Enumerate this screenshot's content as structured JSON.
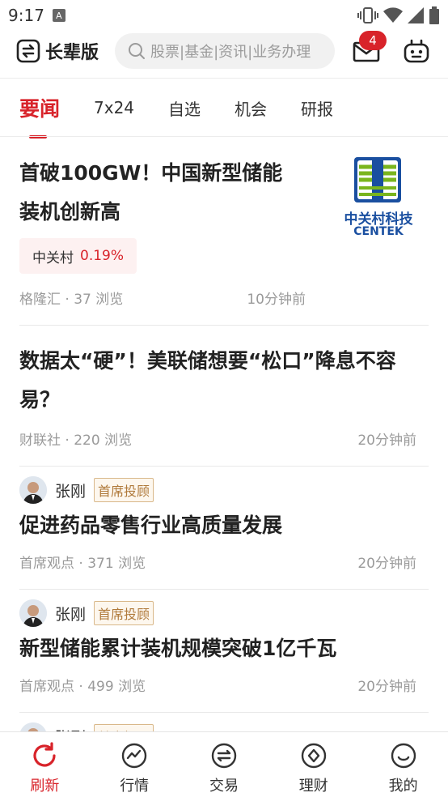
{
  "status_bar": {
    "time": "9:17",
    "notification_glyph": "A"
  },
  "header": {
    "mode_label": "长辈版",
    "search_placeholder": "股票|基金|资讯|业务办理",
    "mail_badge": "4"
  },
  "tabs": [
    {
      "label": "要闻",
      "active": true
    },
    {
      "label": "7x24",
      "active": false
    },
    {
      "label": "自选",
      "active": false
    },
    {
      "label": "机会",
      "active": false
    },
    {
      "label": "研报",
      "active": false
    }
  ],
  "articles": [
    {
      "title_line1": "首破100GW！中国新型储能",
      "title_line2": "装机创新高",
      "stock_name": "中关村",
      "stock_change": "0.19%",
      "source": "格隆汇 · 37 浏览",
      "time": "10分钟前",
      "logo_cn": "中关村科技",
      "logo_en": "CENTEK"
    },
    {
      "title_line1": "数据太“硬”！美联储想要“松口”降息不容",
      "title_line2": "易？",
      "source": "财联社 · 220 浏览",
      "time": "20分钟前"
    },
    {
      "author": "张刚",
      "author_tag": "首席投顾",
      "title": "促进药品零售行业高质量发展",
      "source": "首席观点 · 371 浏览",
      "time": "20分钟前"
    },
    {
      "author": "张刚",
      "author_tag": "首席投顾",
      "title": "新型储能累计装机规模突破1亿千瓦",
      "source": "首席观点 · 499 浏览",
      "time": "20分钟前"
    },
    {
      "author": "张刚",
      "author_tag": "首席投顾"
    }
  ],
  "bottom_nav": [
    {
      "label": "刷新",
      "icon": "refresh-icon",
      "active": true
    },
    {
      "label": "行情",
      "icon": "market-icon",
      "active": false
    },
    {
      "label": "交易",
      "icon": "trade-icon",
      "active": false
    },
    {
      "label": "理财",
      "icon": "wealth-icon",
      "active": false
    },
    {
      "label": "我的",
      "icon": "profile-icon",
      "active": false
    }
  ],
  "colors": {
    "accent": "#d8232a",
    "tag_border": "#d9b88a",
    "logo_blue": "#1a4fa0",
    "logo_green": "#7ab51d"
  }
}
